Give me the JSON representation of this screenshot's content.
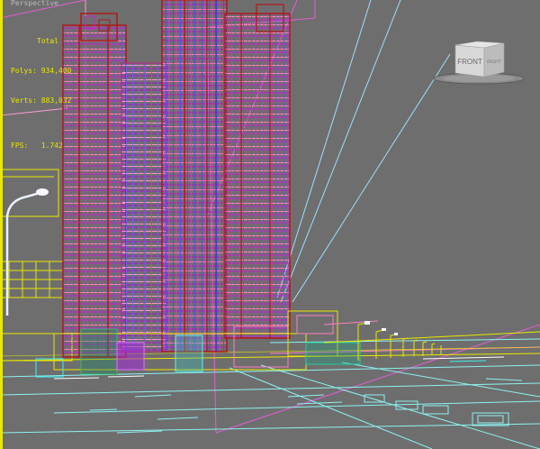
{
  "viewport": {
    "label": "Perspective",
    "background": "#6e6e6e",
    "border_color": "#e8e800"
  },
  "stats": {
    "total_label": "Total",
    "polys_label": "Polys:",
    "polys_value": "934,400",
    "verts_label": "Verts:",
    "verts_value": "883,032",
    "fps_label": "FPS:",
    "fps_value": "1.742",
    "color": "#e8e800"
  },
  "viewcube": {
    "front_label": "FRONT",
    "right_label": "RIGHT"
  },
  "wireframe_colors": {
    "building_magenta": "#d020d0",
    "building_red": "#b01818",
    "building_pink": "#ff80a0",
    "building_blue": "#6060ff",
    "ground_cyan": "#8ef0f0",
    "ground_yellow": "#e8e800",
    "light_blue": "#a0d8ff"
  }
}
